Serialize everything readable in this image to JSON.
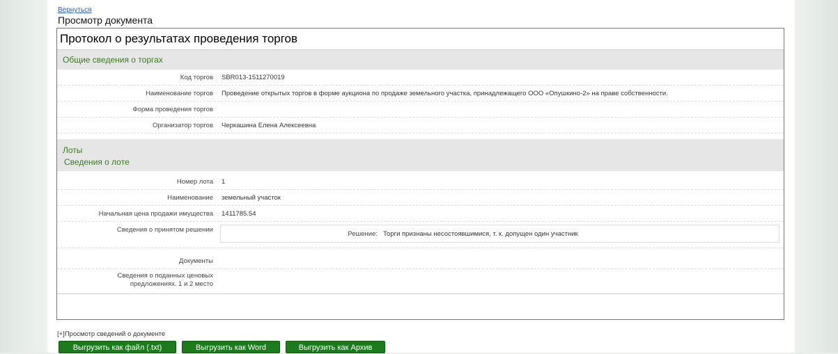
{
  "nav": {
    "back_label": "Вернуться",
    "page_title": "Просмотр документа"
  },
  "doc": {
    "title": "Протокол о результатах проведения торгов",
    "general": {
      "heading": "Общие сведения о торгах",
      "rows": [
        {
          "label": "Код торгов",
          "value": "SBR013-1511270019"
        },
        {
          "label": "Наименование торгов",
          "value": "Проведение открытых торгов в форме аукциона по продаже земельного участка, принадлежащего ООО «Опушкино-2» на праве собственности."
        },
        {
          "label": "Форма проведения торгов",
          "value": ""
        },
        {
          "label": "Организатор торгов",
          "value": "Черкашина Елена Алексеевна"
        }
      ]
    },
    "lots": {
      "heading": "Лоты",
      "lot_heading": "Сведения о лоте",
      "rows": [
        {
          "label": "Номер лота",
          "value": "1"
        },
        {
          "label": "Наименование",
          "value": "земельный участок"
        },
        {
          "label": "Начальная цена продажи имущества",
          "value": "1411785.54"
        }
      ],
      "decision": {
        "label": "Сведения о принятом решении",
        "inner_label": "Решение:",
        "inner_value": "Торги признаны несостоявшимися, т. к. допущен один участник"
      },
      "documents_label": "Документы",
      "bids_label": "Сведения о поданных ценовых предложениях. 1 и 2 место"
    }
  },
  "footer": {
    "details_link": "[+]Просмотр сведений о документе",
    "buttons": [
      "Выгрузить как файл (.txt)",
      "Выгрузить как Word",
      "Выгрузить как Архив"
    ]
  },
  "colors": {
    "accent_green": "#1d7a1d",
    "section_text": "#3a7a1e",
    "link": "#2a5db0"
  }
}
